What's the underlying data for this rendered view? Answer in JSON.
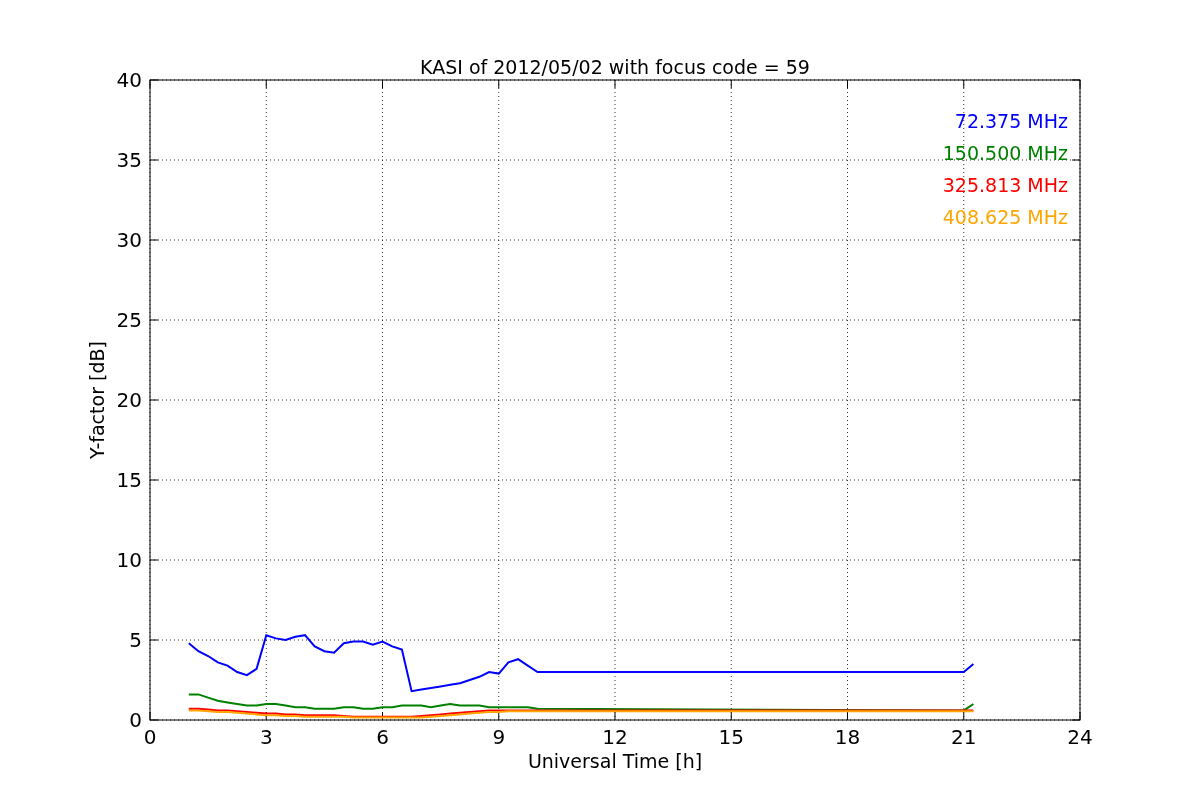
{
  "figure": {
    "chart_data": {
      "type": "line",
      "title": "KASI of 2012/05/02 with focus code = 59",
      "xlabel": "Universal Time [h]",
      "ylabel": "Y-factor [dB]",
      "x": [
        1.0,
        1.25,
        1.5,
        1.75,
        2.0,
        2.25,
        2.5,
        2.75,
        3.0,
        3.25,
        3.5,
        3.75,
        4.0,
        4.25,
        4.5,
        4.75,
        5.0,
        5.25,
        5.5,
        5.75,
        6.0,
        6.25,
        6.5,
        6.75,
        7.0,
        7.25,
        7.5,
        7.75,
        8.0,
        8.25,
        8.5,
        8.75,
        9.0,
        9.25,
        9.5,
        9.75,
        10.0,
        21.0,
        21.25
      ],
      "series": [
        {
          "name": "72.375 MHz",
          "color": "#0000ff",
          "values": [
            4.8,
            4.3,
            4.0,
            3.6,
            3.4,
            3.0,
            2.8,
            3.2,
            5.3,
            5.1,
            5.0,
            5.2,
            5.3,
            4.6,
            4.3,
            4.2,
            4.8,
            4.9,
            4.9,
            4.7,
            4.9,
            4.6,
            4.4,
            1.8,
            1.9,
            2.0,
            2.1,
            2.2,
            2.3,
            2.5,
            2.7,
            3.0,
            2.9,
            3.6,
            3.8,
            3.4,
            3.0,
            3.0,
            3.5
          ]
        },
        {
          "name": "150.500 MHz",
          "color": "#008000",
          "values": [
            1.6,
            1.6,
            1.4,
            1.2,
            1.1,
            1.0,
            0.9,
            0.9,
            1.0,
            1.0,
            0.9,
            0.8,
            0.8,
            0.7,
            0.7,
            0.7,
            0.8,
            0.8,
            0.7,
            0.7,
            0.8,
            0.8,
            0.9,
            0.9,
            0.9,
            0.8,
            0.9,
            1.0,
            0.9,
            0.9,
            0.9,
            0.8,
            0.8,
            0.8,
            0.8,
            0.8,
            0.7,
            0.6,
            1.0
          ]
        },
        {
          "name": "325.813 MHz",
          "color": "#ff0000",
          "values": [
            0.7,
            0.7,
            0.65,
            0.6,
            0.6,
            0.55,
            0.5,
            0.45,
            0.4,
            0.4,
            0.35,
            0.35,
            0.3,
            0.3,
            0.3,
            0.3,
            0.25,
            0.2,
            0.2,
            0.2,
            0.2,
            0.2,
            0.2,
            0.2,
            0.25,
            0.3,
            0.35,
            0.4,
            0.45,
            0.5,
            0.55,
            0.6,
            0.6,
            0.6,
            0.6,
            0.6,
            0.6,
            0.6,
            0.6
          ]
        },
        {
          "name": "408.625 MHz",
          "color": "#ffa500",
          "values": [
            0.6,
            0.6,
            0.55,
            0.5,
            0.5,
            0.45,
            0.4,
            0.35,
            0.3,
            0.3,
            0.25,
            0.25,
            0.2,
            0.2,
            0.2,
            0.2,
            0.2,
            0.15,
            0.15,
            0.15,
            0.15,
            0.15,
            0.15,
            0.15,
            0.15,
            0.2,
            0.25,
            0.3,
            0.35,
            0.4,
            0.45,
            0.5,
            0.5,
            0.55,
            0.55,
            0.55,
            0.55,
            0.55,
            0.55
          ]
        }
      ],
      "grid": true,
      "xlim": [
        0,
        24
      ],
      "ylim": [
        0,
        40
      ],
      "xticks": [
        0,
        3,
        6,
        9,
        12,
        15,
        18,
        21,
        24
      ],
      "yticks": [
        0,
        5,
        10,
        15,
        20,
        25,
        30,
        35,
        40
      ]
    }
  }
}
